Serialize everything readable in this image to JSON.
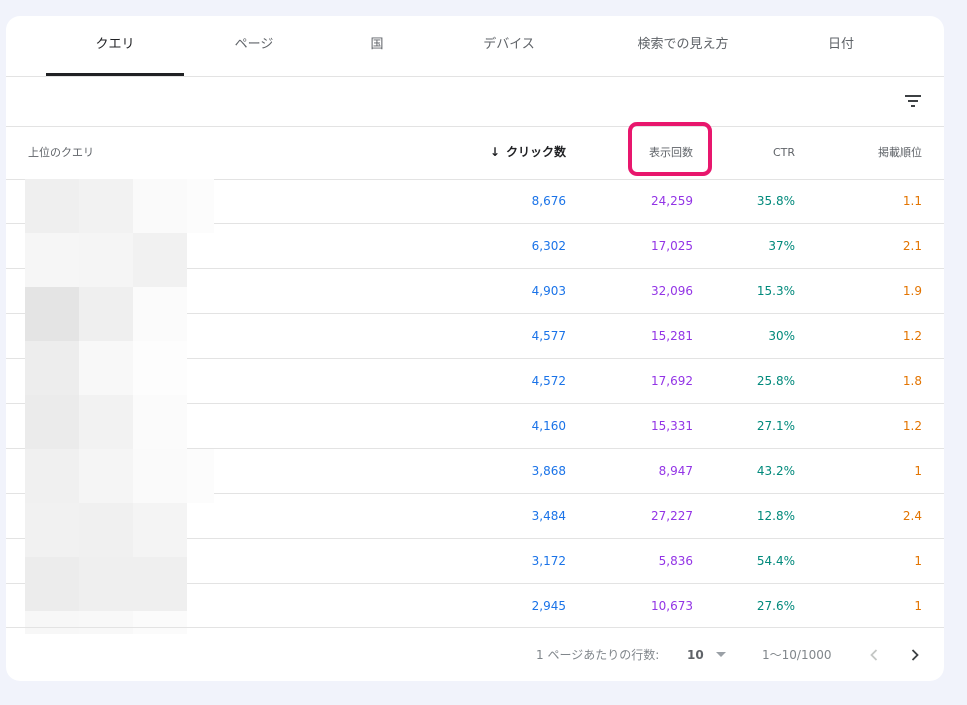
{
  "tabs": [
    {
      "label": "クエリ",
      "active": true
    },
    {
      "label": "ページ",
      "active": false
    },
    {
      "label": "国",
      "active": false
    },
    {
      "label": "デバイス",
      "active": false
    },
    {
      "label": "検索での見え方",
      "active": false
    },
    {
      "label": "日付",
      "active": false
    }
  ],
  "table": {
    "columns": {
      "query": "上位のクエリ",
      "clicks": "クリック数",
      "impressions": "表示回数",
      "ctr": "CTR",
      "position": "掲載順位"
    },
    "sorted_column": "clicks",
    "sort_direction": "descending",
    "highlighted_column": "impressions",
    "rows": [
      {
        "query": "",
        "clicks": "8,676",
        "impressions": "24,259",
        "ctr": "35.8%",
        "position": "1.1"
      },
      {
        "query": "",
        "clicks": "6,302",
        "impressions": "17,025",
        "ctr": "37%",
        "position": "2.1"
      },
      {
        "query": "",
        "clicks": "4,903",
        "impressions": "32,096",
        "ctr": "15.3%",
        "position": "1.9"
      },
      {
        "query": "",
        "clicks": "4,577",
        "impressions": "15,281",
        "ctr": "30%",
        "position": "1.2"
      },
      {
        "query": "",
        "clicks": "4,572",
        "impressions": "17,692",
        "ctr": "25.8%",
        "position": "1.8"
      },
      {
        "query": "",
        "clicks": "4,160",
        "impressions": "15,331",
        "ctr": "27.1%",
        "position": "1.2"
      },
      {
        "query": "",
        "clicks": "3,868",
        "impressions": "8,947",
        "ctr": "43.2%",
        "position": "1"
      },
      {
        "query": "",
        "clicks": "3,484",
        "impressions": "27,227",
        "ctr": "12.8%",
        "position": "2.4"
      },
      {
        "query": "",
        "clicks": "3,172",
        "impressions": "5,836",
        "ctr": "54.4%",
        "position": "1"
      },
      {
        "query": "",
        "clicks": "2,945",
        "impressions": "10,673",
        "ctr": "27.6%",
        "position": "1"
      }
    ]
  },
  "footer": {
    "rows_per_page_label": "1 ページあたりの行数:",
    "rows_per_page_value": "10",
    "range": "1〜10/1000"
  },
  "icons": {
    "filter": "filter-icon",
    "sort": "arrow-down-icon",
    "prev": "chevron-left-icon",
    "next": "chevron-right-icon"
  },
  "colors": {
    "clicks": "#1a73e8",
    "impressions": "#9334e6",
    "ctr": "#00897b",
    "position": "#e37400",
    "highlight": "#e8176d"
  }
}
